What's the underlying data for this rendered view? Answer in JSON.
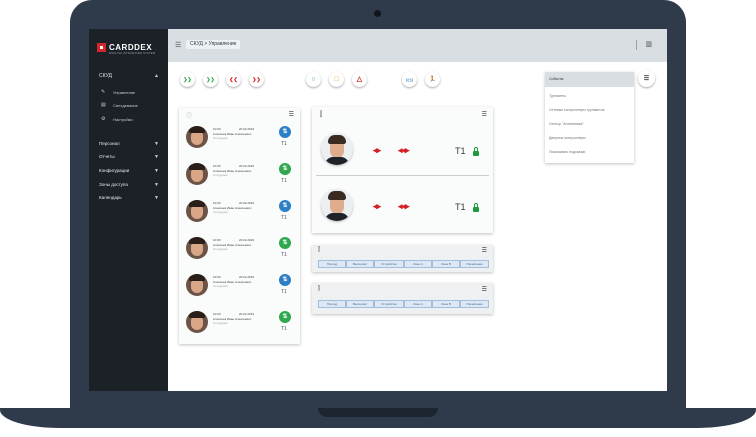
{
  "app": {
    "brand": "CARDDEX",
    "tagline": "ENGLISH INTEGRATED SYSTEM",
    "breadcrumb": "СКУД > Управление"
  },
  "sidebar": {
    "main_section": "СКУД",
    "items": [
      {
        "label": "Управление",
        "icon": "pencil-icon"
      },
      {
        "label": "Синхдевание",
        "icon": "printer-icon"
      },
      {
        "label": "Настройки",
        "icon": "gear-icon"
      }
    ],
    "sections": [
      "Персонал",
      "Отчеты",
      "Конфигурации",
      "Зоны доступа",
      "Календарь"
    ]
  },
  "controls": {
    "nav_buttons": [
      {
        "glyph": "❯❯",
        "color": "#2fa84f",
        "icon": "double-right-green-icon"
      },
      {
        "glyph": "❯❯",
        "color": "#2fa84f",
        "icon": "double-right-green-icon"
      },
      {
        "glyph": "❮❮",
        "color": "#d61f26",
        "icon": "double-left-red-icon"
      },
      {
        "glyph": "❯❯",
        "color": "#d61f26",
        "icon": "double-right-red-icon"
      }
    ],
    "shape_buttons": [
      {
        "glyph": "○",
        "color": "#2fa84f",
        "icon": "circle-icon"
      },
      {
        "glyph": "□",
        "color": "#f29a1a",
        "icon": "square-icon"
      },
      {
        "glyph": "△",
        "color": "#d61f26",
        "icon": "triangle-icon"
      }
    ],
    "mode_buttons": [
      {
        "glyph": "((·))",
        "color": "#2b7fc4",
        "icon": "signal-icon"
      },
      {
        "glyph": "🏃",
        "color": "#d61f26",
        "icon": "running-man-icon"
      }
    ]
  },
  "events": [
    {
      "time": "10:00",
      "date": "20.02.2019",
      "name": "Алексеев Иван Алексеевич",
      "sub": "Сотрудник",
      "status_color": "#2b7fc4",
      "t": "Т1"
    },
    {
      "time": "10:00",
      "date": "20.02.2019",
      "name": "Алексеев Иван Алексеевич",
      "sub": "Сотрудник",
      "status_color": "#2fa84f",
      "t": "Т1"
    },
    {
      "time": "10:00",
      "date": "20.02.2019",
      "name": "Алексеев Иван Алексеевич",
      "sub": "Сотрудник",
      "status_color": "#2b7fc4",
      "t": "Т1"
    },
    {
      "time": "10:00",
      "date": "20.02.2019",
      "name": "Алексеев Иван Алексеевич",
      "sub": "Сотрудник",
      "status_color": "#2fa84f",
      "t": "Т1"
    },
    {
      "time": "10:00",
      "date": "20.02.2019",
      "name": "Алексеев Иван Алексеевич",
      "sub": "Сотрудник",
      "status_color": "#2b7fc4",
      "t": "Т1"
    },
    {
      "time": "10:00",
      "date": "20.02.2019",
      "name": "Алексеев Иван Алексеевич",
      "sub": "Сотрудник",
      "status_color": "#2fa84f",
      "t": "Т1"
    }
  ],
  "turnstile": {
    "label": "Т1",
    "rows": [
      {
        "t": "Т1"
      },
      {
        "t": "Т1"
      }
    ]
  },
  "table_columns": [
    "Проход",
    "Выполнил",
    "Устройство",
    "Зона А",
    "Зона В",
    "Управление"
  ],
  "dropdown": {
    "items": [
      "События",
      "Турникеты",
      "Сетевые контроллеры турникетов",
      "Сенсор \"Антипаника\"",
      "Дверные контроллеры",
      "Показывать подсказки"
    ]
  }
}
